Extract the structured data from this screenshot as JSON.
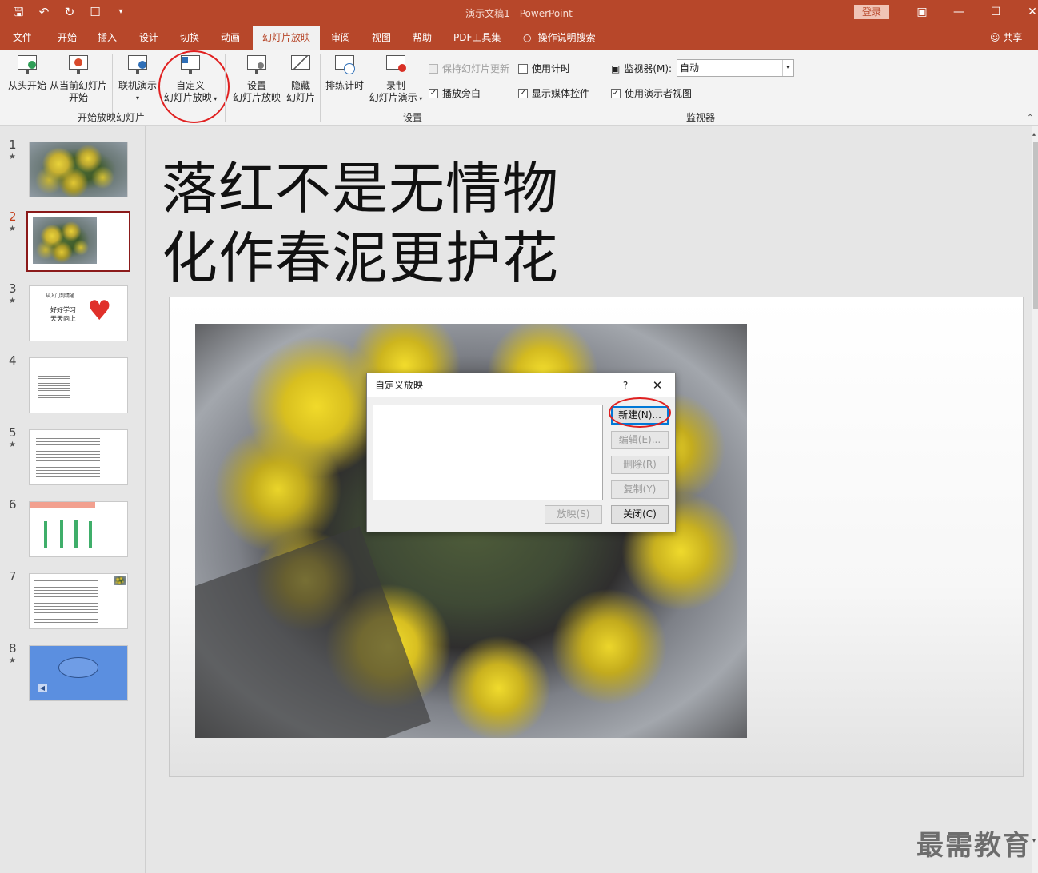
{
  "titlebar": {
    "title": "演示文稿1  -  PowerPoint",
    "login": "登录",
    "qat_icons": [
      "save-icon",
      "undo-icon",
      "redo-icon",
      "touch-mode-icon",
      "customize-icon"
    ],
    "controls": [
      "ribbon-display-icon",
      "minimize-icon",
      "maximize-icon",
      "close-icon"
    ]
  },
  "tabs": [
    "文件",
    "开始",
    "插入",
    "设计",
    "切换",
    "动画",
    "幻灯片放映",
    "审阅",
    "视图",
    "帮助",
    "PDF工具集",
    "操作说明搜索"
  ],
  "active_tab": "幻灯片放映",
  "share": "共享",
  "ribbon": {
    "from_beginning": "从头开始",
    "from_current_1": "从当前幻灯片",
    "from_current_2": "开始",
    "online": "联机演示",
    "custom_1": "自定义",
    "custom_2": "幻灯片放映",
    "group_start": "开始放映幻灯片",
    "setup_1": "设置",
    "setup_2": "幻灯片放映",
    "hide_1": "隐藏",
    "hide_2": "幻灯片",
    "rehearse": "排练计时",
    "record_1": "录制",
    "record_2": "幻灯片演示",
    "keep_updated": "保持幻灯片更新",
    "use_timings": "使用计时",
    "play_narrations": "播放旁白",
    "show_media": "显示媒体控件",
    "group_setup": "设置",
    "monitor_label": "监视器(M):",
    "monitor_value": "自动",
    "presenter_view": "使用演示者视图",
    "group_monitor": "监视器"
  },
  "slides": [
    {
      "number": "1",
      "star": "★"
    },
    {
      "number": "2",
      "star": "★"
    },
    {
      "number": "3",
      "star": "★",
      "line1": "从入门到精通",
      "line2": "好好学习",
      "line3": "天天向上"
    },
    {
      "number": "4",
      "star": ""
    },
    {
      "number": "5",
      "star": "★"
    },
    {
      "number": "6",
      "star": ""
    },
    {
      "number": "7",
      "star": ""
    },
    {
      "number": "8",
      "star": "★"
    }
  ],
  "slide_title": {
    "line1": "落红不是无情物",
    "line2": "化作春泥更护花"
  },
  "dialog": {
    "title": "自定义放映",
    "help": "?",
    "new": "新建(N)...",
    "edit": "编辑(E)...",
    "delete": "删除(R)",
    "copy": "复制(Y)",
    "play": "放映(S)",
    "close": "关闭(C)"
  },
  "watermark": "最需教育"
}
